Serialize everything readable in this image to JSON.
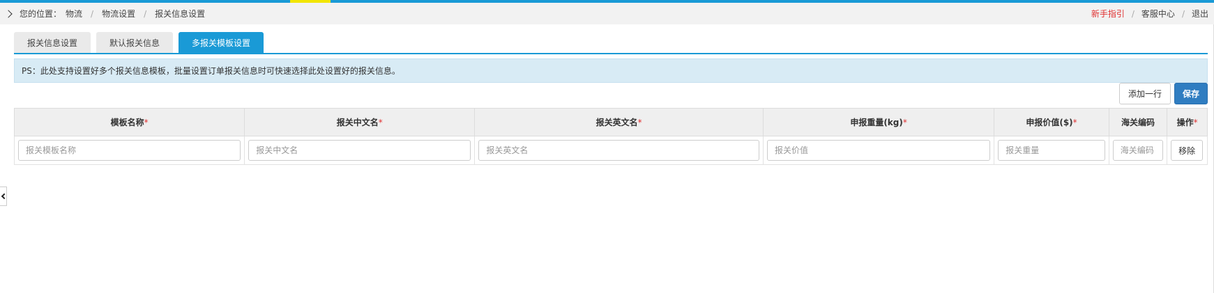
{
  "header": {
    "breadcrumb_prefix": "您的位置：",
    "breadcrumb": [
      "物流",
      "物流设置",
      "报关信息设置"
    ],
    "links": [
      {
        "label": "新手指引",
        "color": "#e03131"
      },
      {
        "label": "客服中心",
        "color": "#444444"
      },
      {
        "label": "退出",
        "color": "#444444"
      }
    ]
  },
  "tabs": [
    {
      "label": "报关信息设置",
      "active": false
    },
    {
      "label": "默认报关信息",
      "active": false
    },
    {
      "label": "多报关模板设置",
      "active": true
    }
  ],
  "notice": "PS：此处支持设置好多个报关信息模板，批量设置订单报关信息时可快速选择此处设置好的报关信息。",
  "actions": {
    "add_row": "添加一行",
    "save": "保存"
  },
  "table": {
    "columns": [
      {
        "label": "模板名称",
        "required": "*"
      },
      {
        "label": "报关中文名",
        "required": "*"
      },
      {
        "label": "报关英文名",
        "required": "*"
      },
      {
        "label": "申报重量(kg)",
        "required": "*"
      },
      {
        "label": "申报价值($)",
        "required": "*"
      },
      {
        "label": "海关编码",
        "required": ""
      },
      {
        "label": "操作",
        "required": "*"
      }
    ],
    "row": {
      "placeholders": [
        "报关模板名称",
        "报关中文名",
        "报关英文名",
        "报关价值",
        "报关重量",
        "海关编码"
      ],
      "values": [
        "",
        "",
        "",
        "",
        "",
        ""
      ],
      "remove_label": "移除"
    }
  },
  "colors": {
    "accent": "#1a9ad6",
    "save_button": "#2f7dc1",
    "required": "#e03131",
    "notice_bg": "#d8ebf5"
  }
}
